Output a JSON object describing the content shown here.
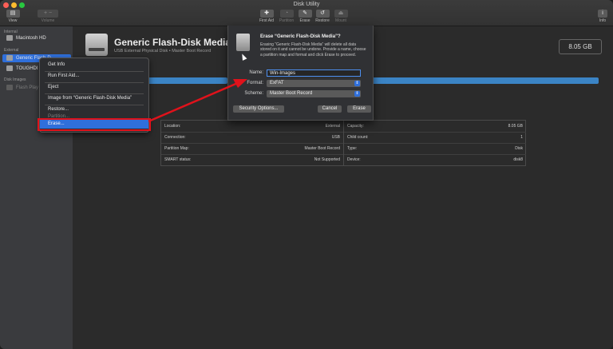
{
  "window": {
    "title": "Disk Utility"
  },
  "traffic_colors": {
    "close": "#ff5f57",
    "minimize": "#febc2e",
    "zoom": "#28c840"
  },
  "toolbar": {
    "view": "View",
    "volume": "Volume",
    "first_aid": "First Aid",
    "partition": "Partition",
    "erase": "Erase",
    "restore": "Restore",
    "mount": "Mount",
    "info": "Info"
  },
  "sidebar": {
    "internal_header": "Internal",
    "internal_disk": "Macintosh HD",
    "external_header": "External",
    "external_disk": "Generic Flash-D",
    "external_disk2": "TOUGHDI",
    "images_header": "Disk Images",
    "image_item": "Flash Play"
  },
  "header": {
    "name": "Generic Flash-Disk Media",
    "subtitle": "USB External Physical Disk • Master Boot Record",
    "capacity": "8.05 GB"
  },
  "info_left": [
    {
      "k": "Location:",
      "v": "External"
    },
    {
      "k": "Connection:",
      "v": "USB"
    },
    {
      "k": "Partition Map:",
      "v": "Master Boot Record"
    },
    {
      "k": "SMART status:",
      "v": "Not Supported"
    }
  ],
  "info_right": [
    {
      "k": "Capacity:",
      "v": "8.05 GB"
    },
    {
      "k": "Child count:",
      "v": "1"
    },
    {
      "k": "Type:",
      "v": "Disk"
    },
    {
      "k": "Device:",
      "v": "disk8"
    }
  ],
  "context_menu": {
    "get_info": "Get Info",
    "run_first_aid": "Run First Aid...",
    "eject": "Eject",
    "image_from": "Image from “Generic Flash-Disk Media”",
    "restore": "Restore...",
    "partition": "Partition...",
    "erase": "Erase..."
  },
  "dialog": {
    "title": "Erase “Generic Flash-Disk Media”?",
    "message": "Erasing “Generic Flash-Disk Media” will delete all data stored on it and cannot be undone. Provide a name, choose a partition map and format and click Erase to proceed.",
    "name_label": "Name:",
    "name_value": "Win-Images",
    "format_label": "Format:",
    "format_value": "ExFAT",
    "scheme_label": "Scheme:",
    "scheme_value": "Master Boot Record",
    "security_button": "Security Options...",
    "cancel_button": "Cancel",
    "erase_button": "Erase"
  },
  "annotation_color": "#e0121b"
}
